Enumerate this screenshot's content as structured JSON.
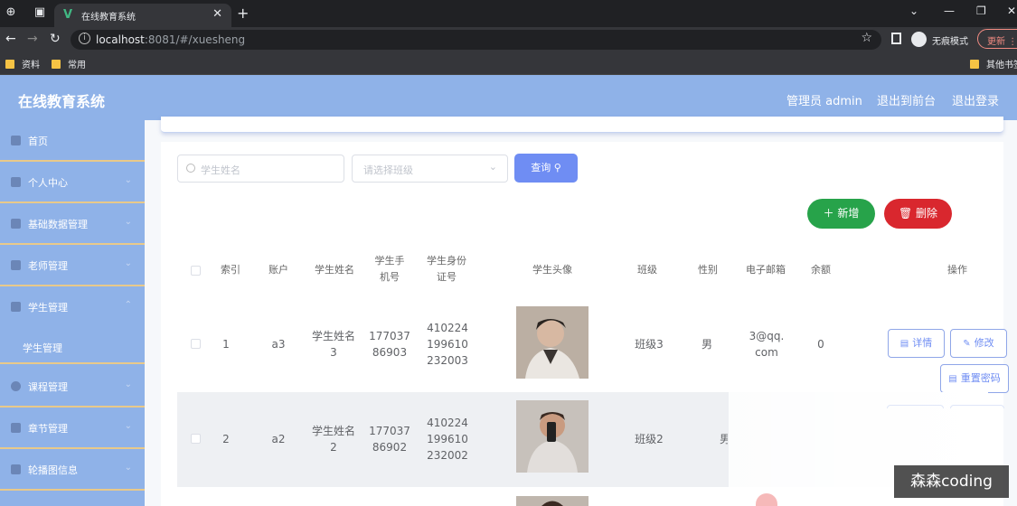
{
  "browser": {
    "tab_title": "在线教育系统",
    "url_host": "localhost",
    "url_rest": ":8081/#/xuesheng",
    "incognito_label": "无痕模式",
    "update_label": "更新",
    "bookmarks": [
      "资料",
      "常用"
    ],
    "other_bookmarks": "其他书签"
  },
  "header": {
    "title": "在线教育系统",
    "admin_label": "管理员 admin",
    "to_front_label": "退出到前台",
    "logout_label": "退出登录"
  },
  "sidebar": {
    "items": [
      {
        "label": "首页"
      },
      {
        "label": "个人中心"
      },
      {
        "label": "基础数据管理"
      },
      {
        "label": "老师管理"
      },
      {
        "label": "学生管理"
      },
      {
        "label": "课程管理"
      },
      {
        "label": "章节管理"
      },
      {
        "label": "轮播图信息"
      }
    ],
    "sub_item": "学生管理"
  },
  "search": {
    "name_placeholder": "学生姓名",
    "class_placeholder": "请选择班级",
    "query_label": "查询"
  },
  "actions": {
    "add_label": "新增",
    "delete_label": "删除"
  },
  "table": {
    "headers": {
      "index": "索引",
      "account": "账户",
      "name": "学生姓名",
      "phone": "学生手机号",
      "id_card": "学生身份证号",
      "avatar": "学生头像",
      "class": "班级",
      "gender": "性别",
      "email": "电子邮箱",
      "balance": "余额",
      "ops": "操作"
    },
    "rows": [
      {
        "index": "1",
        "account": "a3",
        "name": "学生姓名3",
        "phone": "17703786903",
        "id_card": "410224199610232003",
        "class": "班级3",
        "gender": "男",
        "email": "3@qq.com",
        "balance": "0",
        "detail": "详情",
        "edit": "修改",
        "reset": "重置密码"
      },
      {
        "index": "2",
        "account": "a2",
        "name": "学生姓名2",
        "phone": "17703786902",
        "id_card": "410224199610232002",
        "class": "班级2",
        "gender": "男"
      }
    ]
  },
  "watermark": "森森coding",
  "colors": {
    "header_bg": "#8fb2e8",
    "primary": "#6f8df3",
    "success": "#27a34a",
    "danger": "#d9272e",
    "menu_divider": "#e8c98a"
  }
}
